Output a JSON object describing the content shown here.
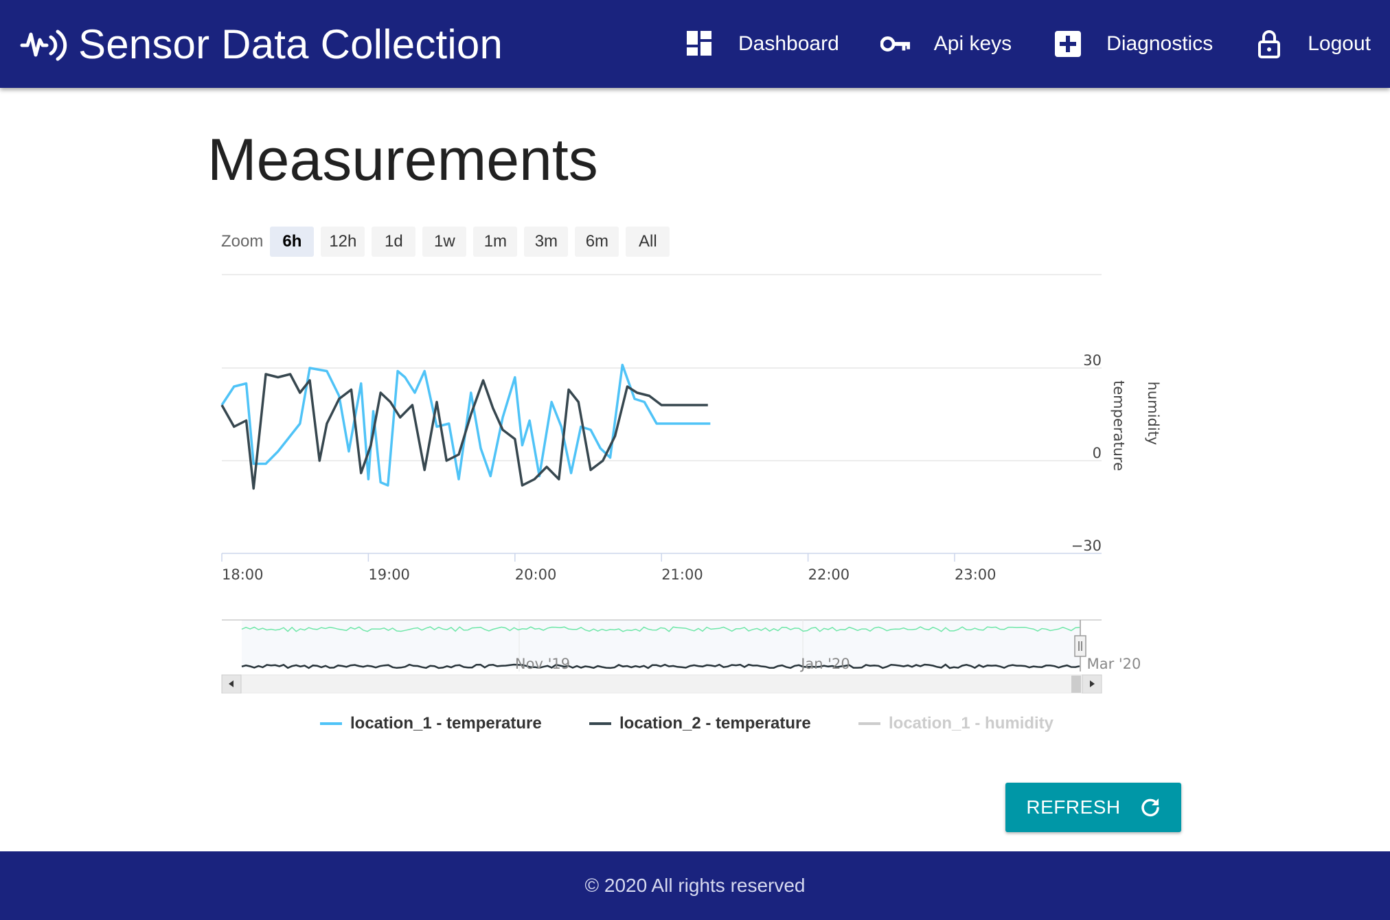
{
  "app": {
    "title": "Sensor Data Collection",
    "logo_icon": "sensor-wave-icon"
  },
  "nav": [
    {
      "label": "Dashboard",
      "icon": "dashboard-icon"
    },
    {
      "label": "Api keys",
      "icon": "key-icon"
    },
    {
      "label": "Diagnostics",
      "icon": "medical-plus-icon"
    },
    {
      "label": "Logout",
      "icon": "lock-icon"
    }
  ],
  "page": {
    "title": "Measurements"
  },
  "zoom": {
    "label": "Zoom",
    "options": [
      "6h",
      "12h",
      "1d",
      "1w",
      "1m",
      "3m",
      "6m",
      "All"
    ],
    "selected": "6h"
  },
  "chart_data": {
    "type": "line",
    "x_ticks": [
      "18:00",
      "19:00",
      "20:00",
      "21:00",
      "22:00",
      "23:00"
    ],
    "y_ticks": [
      "30",
      "0",
      "−30"
    ],
    "ylim": [
      -30,
      30
    ],
    "xlim": [
      "18:00",
      "24:00"
    ],
    "y_axis_labels": [
      "temperature",
      "humidity"
    ],
    "grid": true,
    "legend_position": "bottom",
    "series": [
      {
        "name": "location_1 - temperature",
        "color": "#4fc3f7",
        "visible": true,
        "x": [
          "18:00",
          "18:05",
          "18:10",
          "18:13",
          "18:18",
          "18:23",
          "18:28",
          "18:32",
          "18:36",
          "18:43",
          "18:48",
          "18:52",
          "18:57",
          "19:00",
          "19:02",
          "19:05",
          "19:08",
          "19:12",
          "19:15",
          "19:19",
          "19:23",
          "19:28",
          "19:33",
          "19:37",
          "19:42",
          "19:46",
          "19:50",
          "19:55",
          "20:00",
          "20:03",
          "20:06",
          "20:10",
          "20:15",
          "20:19",
          "20:23",
          "20:27",
          "20:31",
          "20:35",
          "20:39",
          "20:44",
          "20:49",
          "20:53",
          "20:58",
          "21:00",
          "21:03",
          "21:07",
          "21:12",
          "21:16",
          "21:20"
        ],
        "y": [
          18,
          24,
          25,
          -1,
          -1,
          3,
          8,
          12,
          30,
          29,
          21,
          3,
          25,
          -6,
          16,
          -7,
          -8,
          29,
          27,
          22,
          29,
          11,
          12,
          -6,
          22,
          4,
          -5,
          14,
          27,
          5,
          13,
          -5,
          19,
          11,
          -4,
          11,
          10,
          4,
          1,
          31,
          20,
          19,
          12,
          12,
          12,
          12,
          12,
          12,
          12
        ]
      },
      {
        "name": "location_2 - temperature",
        "color": "#37474f",
        "visible": true,
        "x": [
          "18:00",
          "18:05",
          "18:10",
          "18:13",
          "18:18",
          "18:23",
          "18:28",
          "18:32",
          "18:36",
          "18:40",
          "18:43",
          "18:48",
          "18:53",
          "18:57",
          "19:01",
          "19:05",
          "19:09",
          "19:13",
          "19:18",
          "19:23",
          "19:28",
          "19:32",
          "19:37",
          "19:42",
          "19:47",
          "19:51",
          "19:55",
          "20:00",
          "20:03",
          "20:08",
          "20:13",
          "20:18",
          "20:22",
          "20:26",
          "20:31",
          "20:36",
          "20:41",
          "20:46",
          "20:50",
          "20:55",
          "21:00",
          "21:04",
          "21:08",
          "21:13",
          "21:19"
        ],
        "y": [
          18,
          11,
          13,
          -9,
          28,
          27,
          28,
          22,
          26,
          0,
          12,
          20,
          23,
          -4,
          5,
          22,
          19,
          14,
          18,
          -3,
          19,
          0,
          2,
          15,
          26,
          17,
          10,
          7,
          -8,
          -6,
          -2,
          -6,
          23,
          19,
          -3,
          0,
          8,
          24,
          22,
          21,
          18,
          18,
          18,
          18,
          18
        ]
      },
      {
        "name": "location_1 - humidity",
        "color": "#cccccc",
        "visible": false,
        "x": [],
        "y": []
      }
    ],
    "navigator": {
      "x_labels": [
        "Nov '19",
        "Jan '20",
        "Mar '20"
      ]
    }
  },
  "actions": {
    "refresh_label": "REFRESH",
    "refresh_icon": "refresh-icon"
  },
  "footer": {
    "text": "© 2020 All rights reserved"
  }
}
